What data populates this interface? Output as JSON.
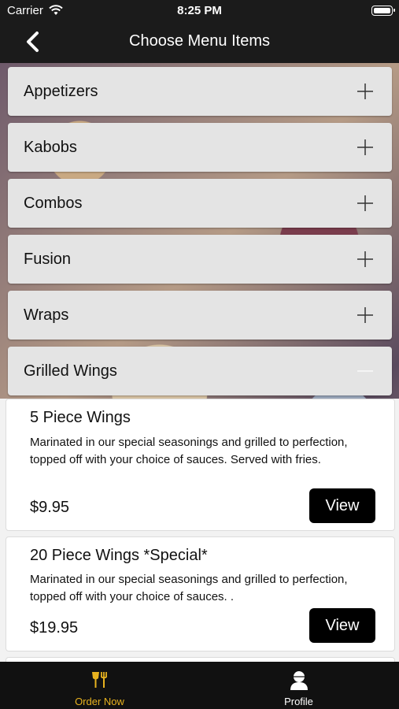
{
  "status_bar": {
    "carrier": "Carrier",
    "time": "8:25 PM"
  },
  "header": {
    "title": "Choose Menu Items",
    "back_icon": "chevron-left-icon"
  },
  "categories": [
    {
      "label": "Appetizers",
      "state": "collapsed"
    },
    {
      "label": "Kabobs",
      "state": "collapsed"
    },
    {
      "label": "Combos",
      "state": "collapsed"
    },
    {
      "label": "Fusion",
      "state": "collapsed"
    },
    {
      "label": "Wraps",
      "state": "collapsed"
    },
    {
      "label": "Grilled Wings",
      "state": "expanded"
    }
  ],
  "items": [
    {
      "name": "5 Piece Wings",
      "description": "Marinated in our special seasonings and grilled to perfection, topped off with your choice of sauces. Served with fries.",
      "price": "$9.95",
      "button": "View"
    },
    {
      "name": "20 Piece Wings *Special*",
      "description": "Marinated in our special seasonings and grilled to perfection, topped off with your choice of sauces. .",
      "price": "$19.95",
      "button": "View"
    }
  ],
  "tab_bar": {
    "tabs": [
      {
        "label": "Order Now",
        "icon": "food-icon",
        "active": true
      },
      {
        "label": "Profile",
        "icon": "user-icon",
        "active": false
      }
    ]
  },
  "colors": {
    "accent": "#e8b21f",
    "nav_background": "#1b1b1b",
    "tab_inactive": "#ffffff"
  }
}
